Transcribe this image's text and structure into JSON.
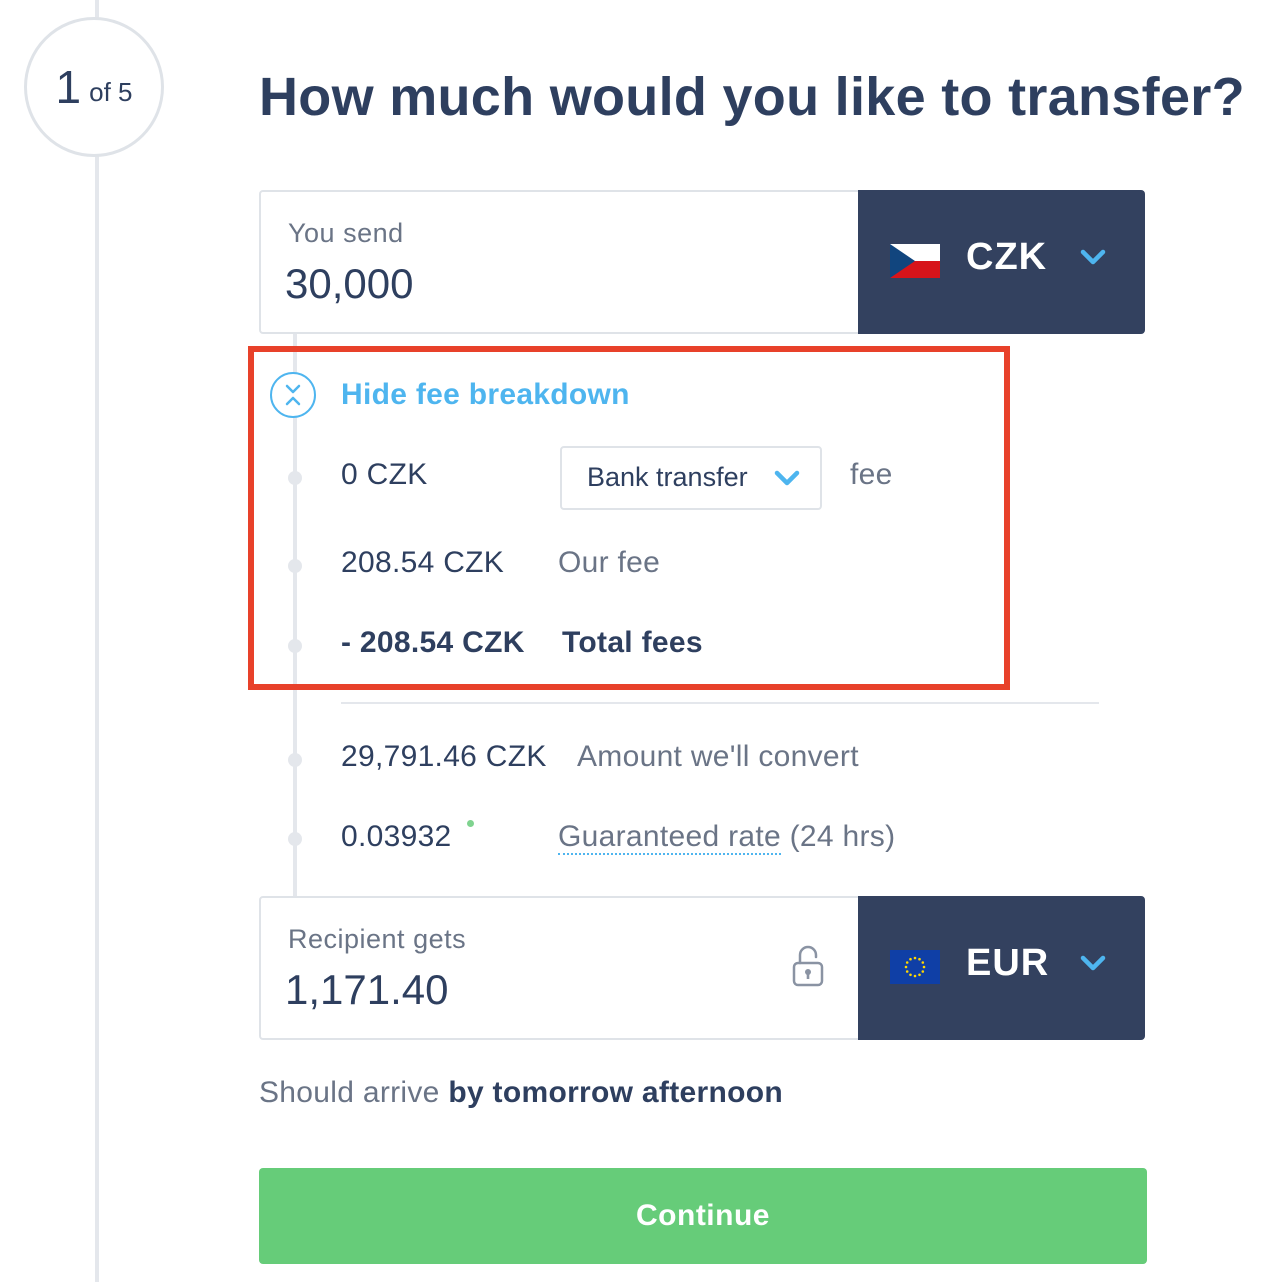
{
  "step": {
    "current": "1",
    "of_label": "of 5"
  },
  "title": "How much would you like to transfer?",
  "send": {
    "label": "You send",
    "amount": "30,000",
    "currency": "CZK",
    "flag_icon": "flag-cz-icon"
  },
  "fees": {
    "toggle_label": "Hide fee breakdown",
    "payment_fee": {
      "amount": "0 CZK",
      "method": "Bank transfer",
      "suffix": "fee"
    },
    "our_fee": {
      "amount": "208.54 CZK",
      "label": "Our fee"
    },
    "total": {
      "amount": "- 208.54 CZK",
      "label": "Total fees"
    }
  },
  "convert": {
    "amount": "29,791.46 CZK",
    "label": "Amount we'll convert"
  },
  "rate": {
    "value": "0.03932",
    "link_label": "Guaranteed rate",
    "suffix": "(24 hrs)"
  },
  "receive": {
    "label": "Recipient gets",
    "amount": "1,171.40",
    "currency": "EUR",
    "flag_icon": "flag-eu-icon"
  },
  "arrival": {
    "prefix": "Should arrive",
    "time": "by tomorrow afternoon"
  },
  "continue_label": "Continue",
  "colors": {
    "navy": "#33415f",
    "accent_blue": "#4eb5ef",
    "green": "#66cc79",
    "highlight_red": "#e8412a"
  }
}
